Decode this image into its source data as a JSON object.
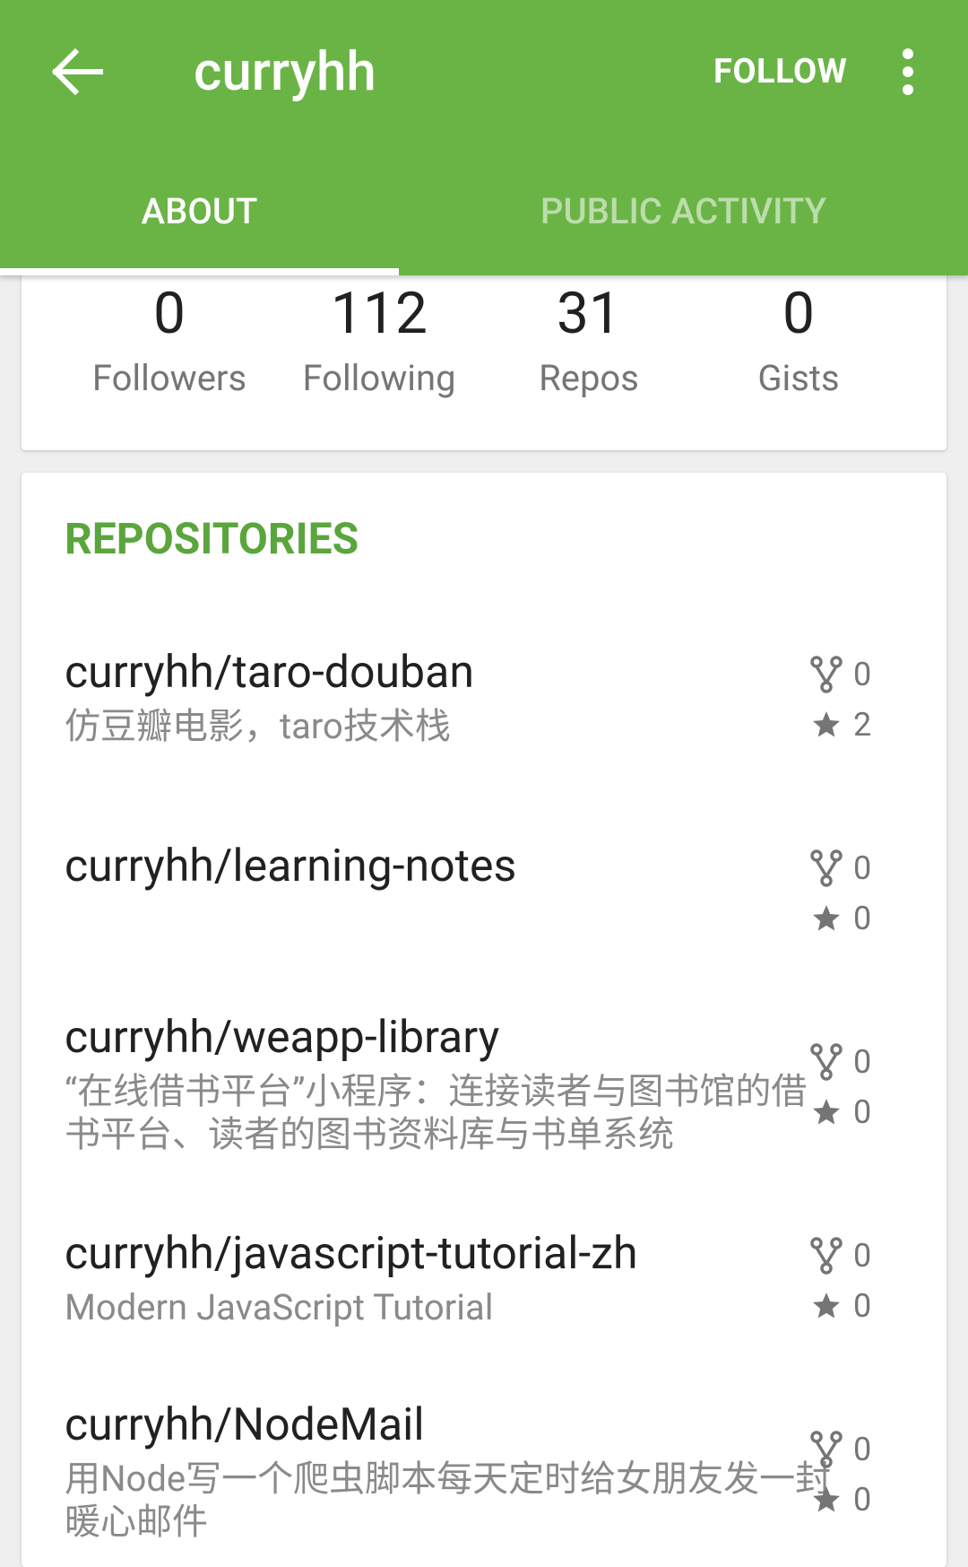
{
  "header": {
    "title": "curryhh",
    "follow_label": "FOLLOW",
    "tabs": [
      "ABOUT",
      "PUBLIC ACTIVITY"
    ],
    "colors": {
      "primary": "#6ab446",
      "accent": "#5aa63c"
    }
  },
  "stats": [
    {
      "value": "0",
      "label": "Followers"
    },
    {
      "value": "112",
      "label": "Following"
    },
    {
      "value": "31",
      "label": "Repos"
    },
    {
      "value": "0",
      "label": "Gists"
    }
  ],
  "repositories": {
    "title": "REPOSITORIES",
    "items": [
      {
        "name": "curryhh/taro-douban",
        "description": "仿豆瓣电影，taro技术栈",
        "forks": "0",
        "stars": "2"
      },
      {
        "name": "curryhh/learning-notes",
        "description": "",
        "forks": "0",
        "stars": "0"
      },
      {
        "name": "curryhh/weapp-library",
        "description": "“在线借书平台”小程序：连接读者与图书馆的借书平台、读者的图书资料库与书单系统",
        "forks": "0",
        "stars": "0"
      },
      {
        "name": "curryhh/javascript-tutorial-zh",
        "description": "Modern JavaScript Tutorial",
        "forks": "0",
        "stars": "0"
      },
      {
        "name": "curryhh/NodeMail",
        "description": "用Node写一个爬虫脚本每天定时给女朋友发一封暖心邮件",
        "forks": "0",
        "stars": "0"
      }
    ]
  },
  "icons": {
    "back": "arrow-back-icon",
    "menu": "more-vert-icon",
    "fork": "fork-icon",
    "star": "star-icon"
  }
}
